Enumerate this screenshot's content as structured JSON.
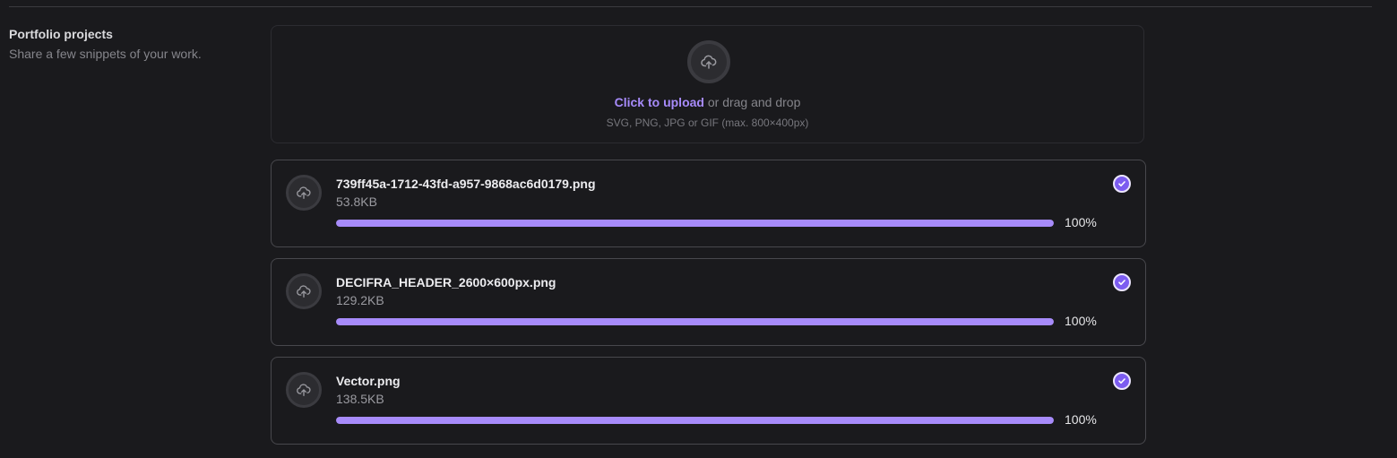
{
  "section": {
    "title": "Portfolio projects",
    "description": "Share a few snippets of your work."
  },
  "dropzone": {
    "link_text": "Click to upload",
    "rest_text": " or drag and drop",
    "hint": "SVG, PNG, JPG or GIF (max. 800×400px)",
    "icon": "cloud-upload-icon"
  },
  "files": [
    {
      "name": "739ff45a-1712-43fd-a957-9868ac6d0179.png",
      "size": "53.8KB",
      "progress": 100,
      "progress_label": "100%",
      "status_icon": "check-circle-icon"
    },
    {
      "name": "DECIFRA_HEADER_2600×600px.png",
      "size": "129.2KB",
      "progress": 100,
      "progress_label": "100%",
      "status_icon": "check-circle-icon"
    },
    {
      "name": "Vector.png",
      "size": "138.5KB",
      "progress": 100,
      "progress_label": "100%",
      "status_icon": "check-circle-icon"
    }
  ],
  "colors": {
    "accent": "#a78bfa",
    "check": "#7c5cf0",
    "background": "#1a1a1d"
  }
}
